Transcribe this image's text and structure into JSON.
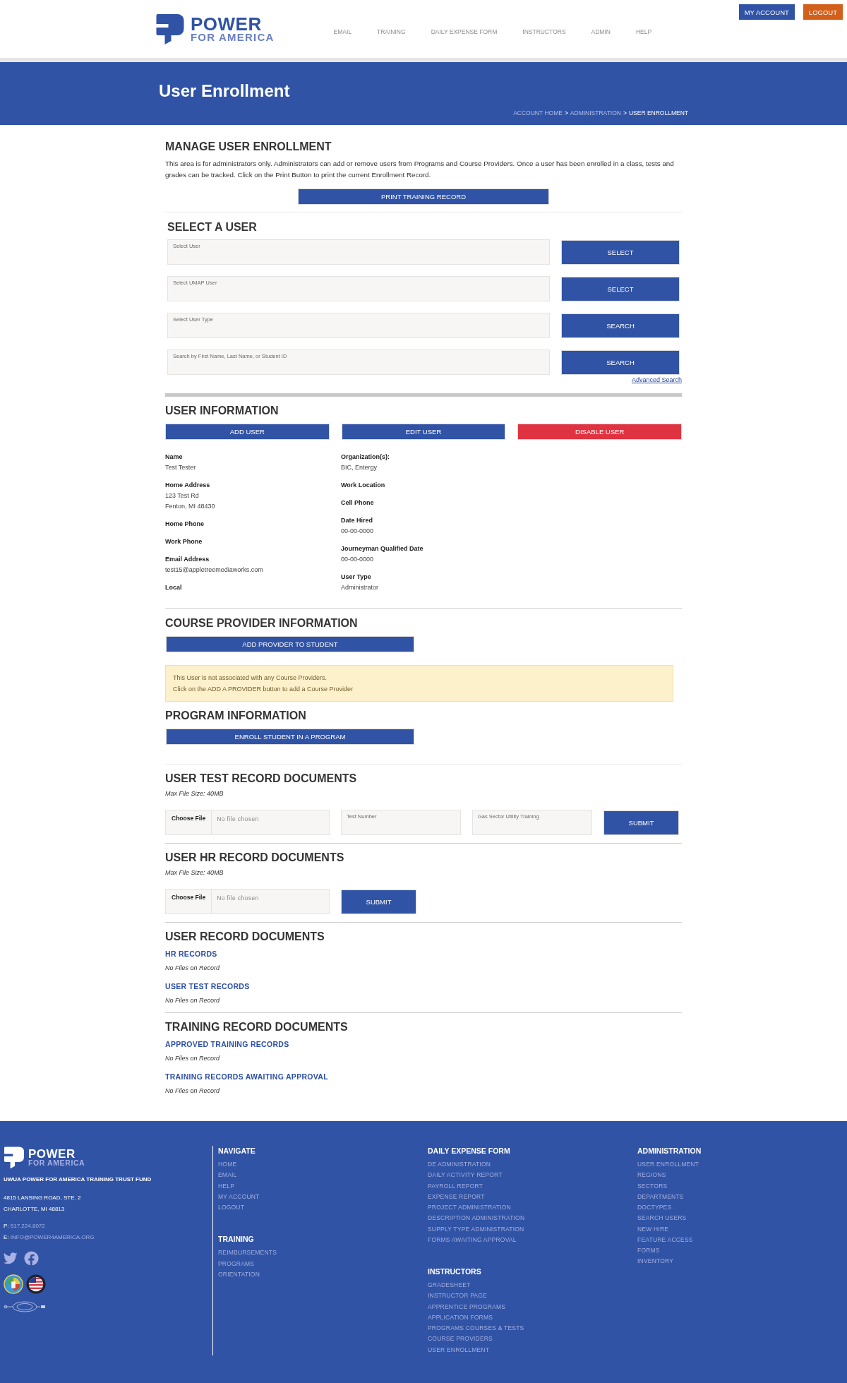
{
  "header": {
    "logo": {
      "title": "POWER",
      "subtitle": "FOR AMERICA"
    },
    "nav": [
      "EMAIL",
      "TRAINING",
      "DAILY EXPENSE FORM",
      "INSTRUCTORS",
      "ADMIN",
      "HELP"
    ],
    "account_buttons": [
      {
        "label": "MY ACCOUNT",
        "kind": "primary"
      },
      {
        "label": "LOGOUT",
        "kind": "warning"
      }
    ]
  },
  "banner": {
    "title": "User Enrollment",
    "separator": ">",
    "breadcrumb": [
      {
        "label": "ACCOUNT HOME",
        "current": false
      },
      {
        "label": "ADMINISTRATION",
        "current": false
      },
      {
        "label": "USER ENROLLMENT",
        "current": true
      }
    ]
  },
  "manage": {
    "title": "MANAGE USER ENROLLMENT",
    "description": "This area is for administrators only. Administrators can add or remove users from Programs and Course Providers. Once a user has been enrolled in a class, tests and grades can be tracked. Click on the Print Button to print the current Enrollment Record.",
    "button": "PRINT TRAINING RECORD"
  },
  "select_user": {
    "title": "SELECT A USER",
    "rows": [
      {
        "placeholder": "Select User",
        "button": "SELECT"
      },
      {
        "placeholder": "Select UMAP User",
        "button": "SELECT"
      },
      {
        "placeholder": "Select User Type",
        "button": "SEARCH"
      },
      {
        "placeholder": "Search by First Name, Last Name, or Student ID",
        "button": "SEARCH"
      }
    ],
    "link": "Advanced Search"
  },
  "user_information": {
    "title": "USER INFORMATION",
    "buttons": [
      {
        "label": "ADD USER",
        "kind": "primary"
      },
      {
        "label": "EDIT USER",
        "kind": "primary"
      },
      {
        "label": "DISABLE USER",
        "kind": "danger"
      }
    ],
    "columns": [
      [
        {
          "label": "Name",
          "value": [
            "Test Tester"
          ]
        },
        {
          "label": "Home Address",
          "value": [
            "123 Test Rd",
            "Fenton, MI 48430"
          ]
        },
        {
          "label": "Home Phone"
        },
        {
          "label": "Work Phone"
        },
        {
          "label": "Email Address",
          "value": [
            "test15@appletreemediaworks.com"
          ]
        },
        {
          "label": "Local"
        }
      ],
      [
        {
          "label": "Organization(s):",
          "value": [
            "BIC, Entergy"
          ]
        },
        {
          "label": "Work Location"
        },
        {
          "label": "Cell Phone"
        },
        {
          "label": "Date Hired",
          "value": [
            "00-00-0000"
          ]
        },
        {
          "label": "Journeyman Qualified Date",
          "value": [
            "00-00-0000"
          ]
        },
        {
          "label": "User Type",
          "value": [
            "Administrator"
          ]
        }
      ]
    ]
  },
  "course_provider": {
    "title": "COURSE PROVIDER INFORMATION",
    "button": "ADD PROVIDER TO STUDENT",
    "notice": [
      "This User is not associated with any Course Providers.",
      "Click on the ADD A PROVIDER button to add a Course Provider"
    ]
  },
  "program": {
    "title": "PROGRAM INFORMATION",
    "button": "ENROLL STUDENT IN A PROGRAM"
  },
  "uploads": [
    {
      "title": "USER TEST RECORD DOCUMENTS",
      "note": "Max File Size: 40MB",
      "file_button": "Choose File",
      "file_status": "No file chosen",
      "fields": [
        {
          "placeholder": "Test Number"
        },
        {
          "placeholder": "Gas Sector Utility Training"
        }
      ],
      "submit": "SUBMIT"
    },
    {
      "title": "USER HR RECORD DOCUMENTS",
      "note": "Max File Size: 40MB",
      "file_button": "Choose File",
      "file_status": "No file chosen",
      "submit": "SUBMIT"
    }
  ],
  "documents": [
    {
      "title": "USER RECORD DOCUMENTS",
      "groups": [
        {
          "title": "HR RECORDS",
          "empty": "No Files on Record"
        },
        {
          "title": "USER TEST RECORDS",
          "empty": "No Files on Record"
        }
      ]
    },
    {
      "title": "TRAINING RECORD DOCUMENTS",
      "groups": [
        {
          "title": "APPROVED TRAINING RECORDS",
          "empty": "No Files on Record"
        },
        {
          "title": "TRAINING RECORDS AWAITING APPROVAL",
          "empty": "No Files on Record"
        }
      ]
    }
  ],
  "footer": {
    "logo": {
      "title": "POWER",
      "subtitle": "FOR AMERICA"
    },
    "org": "UWUA POWER FOR AMERICA TRAINING TRUST FUND",
    "address": [
      "4815 LANSING ROAD, STE. 2",
      "CHARLOTTE, MI 48813"
    ],
    "contacts": [
      {
        "label": "P:",
        "value": "517.224.8072"
      },
      {
        "label": "E:",
        "value": "INFO@POWER4AMERICA.ORG"
      }
    ],
    "columns": [
      [
        {
          "title": "NAVIGATE",
          "links": [
            "HOME",
            "EMAIL",
            "HELP",
            "MY ACCOUNT",
            "LOGOUT"
          ]
        },
        {
          "title": "TRAINING",
          "links": [
            "REIMBURSEMENTS",
            "PROGRAMS",
            "ORIENTATION"
          ]
        }
      ],
      [
        {
          "title": "DAILY EXPENSE FORM",
          "links": [
            "DE ADMINISTRATION",
            "DAILY ACTIVITY REPORT",
            "PAYROLL REPORT",
            "EXPENSE REPORT",
            "PROJECT ADMINISTRATION",
            "DESCRIPTION ADMINISTRATION",
            "SUPPLY TYPE ADMINISTRATION",
            "FORMS AWAITING APPROVAL"
          ]
        },
        {
          "title": "INSTRUCTORS",
          "links": [
            "GRADESHEET",
            "INSTRUCTOR PAGE",
            "APPRENTICE PROGRAMS",
            "APPLICATION FORMS",
            "PROGRAMS COURSES & TESTS",
            "COURSE PROVIDERS",
            "USER ENROLLMENT"
          ]
        }
      ],
      [
        {
          "title": "ADMINISTRATION",
          "links": [
            "USER ENROLLMENT",
            "REGIONS",
            "SECTORS",
            "DEPARTMENTS",
            "DOCTYPES",
            "SEARCH USERS",
            "NEW HIRE",
            "FEATURE ACCESS",
            "FORMS",
            "INVENTORY"
          ]
        }
      ]
    ]
  }
}
